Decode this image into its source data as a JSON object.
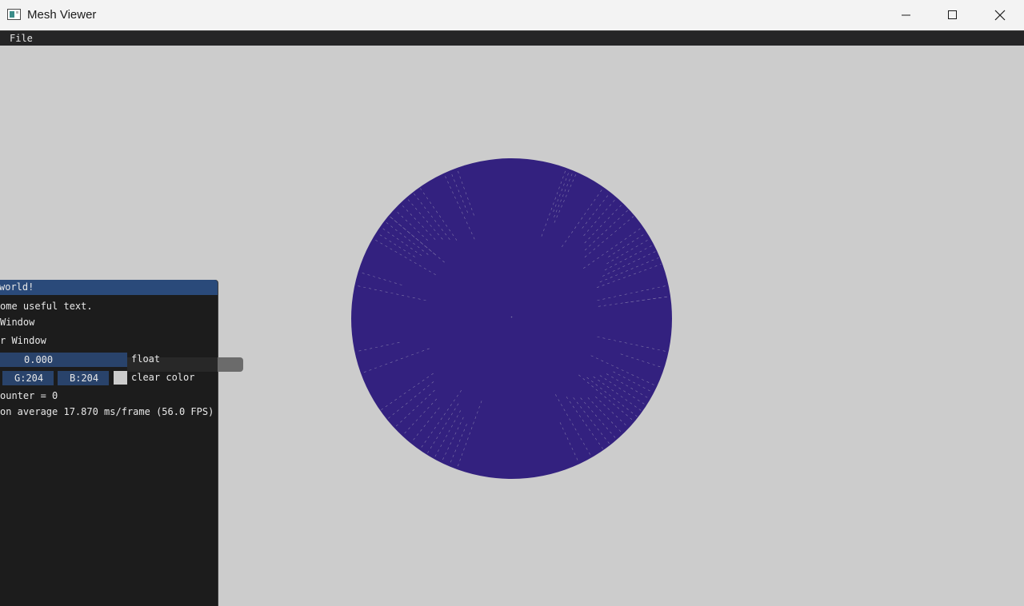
{
  "window": {
    "title": "Mesh Viewer",
    "icon": "app-window-icon",
    "controls": [
      "minimize-icon",
      "maximize-icon",
      "close-icon"
    ]
  },
  "menubar": {
    "items": [
      "File"
    ]
  },
  "viewport": {
    "clear_color": "#cccccc",
    "mesh_color": "#33217f",
    "mesh_shape": "circle"
  },
  "imgui_window": {
    "title": "world!",
    "text_line": "ome useful text.",
    "checkbox_demo": "Window",
    "checkbox_another": "r Window",
    "slider": {
      "value": "0.000",
      "label": "float"
    },
    "color": {
      "g": "G:204",
      "b": "B:204",
      "label": "clear color",
      "swatch": "#cccccc"
    },
    "counter": "ounter = 0",
    "fps": "on average 17.870 ms/frame (56.0 FPS)"
  }
}
